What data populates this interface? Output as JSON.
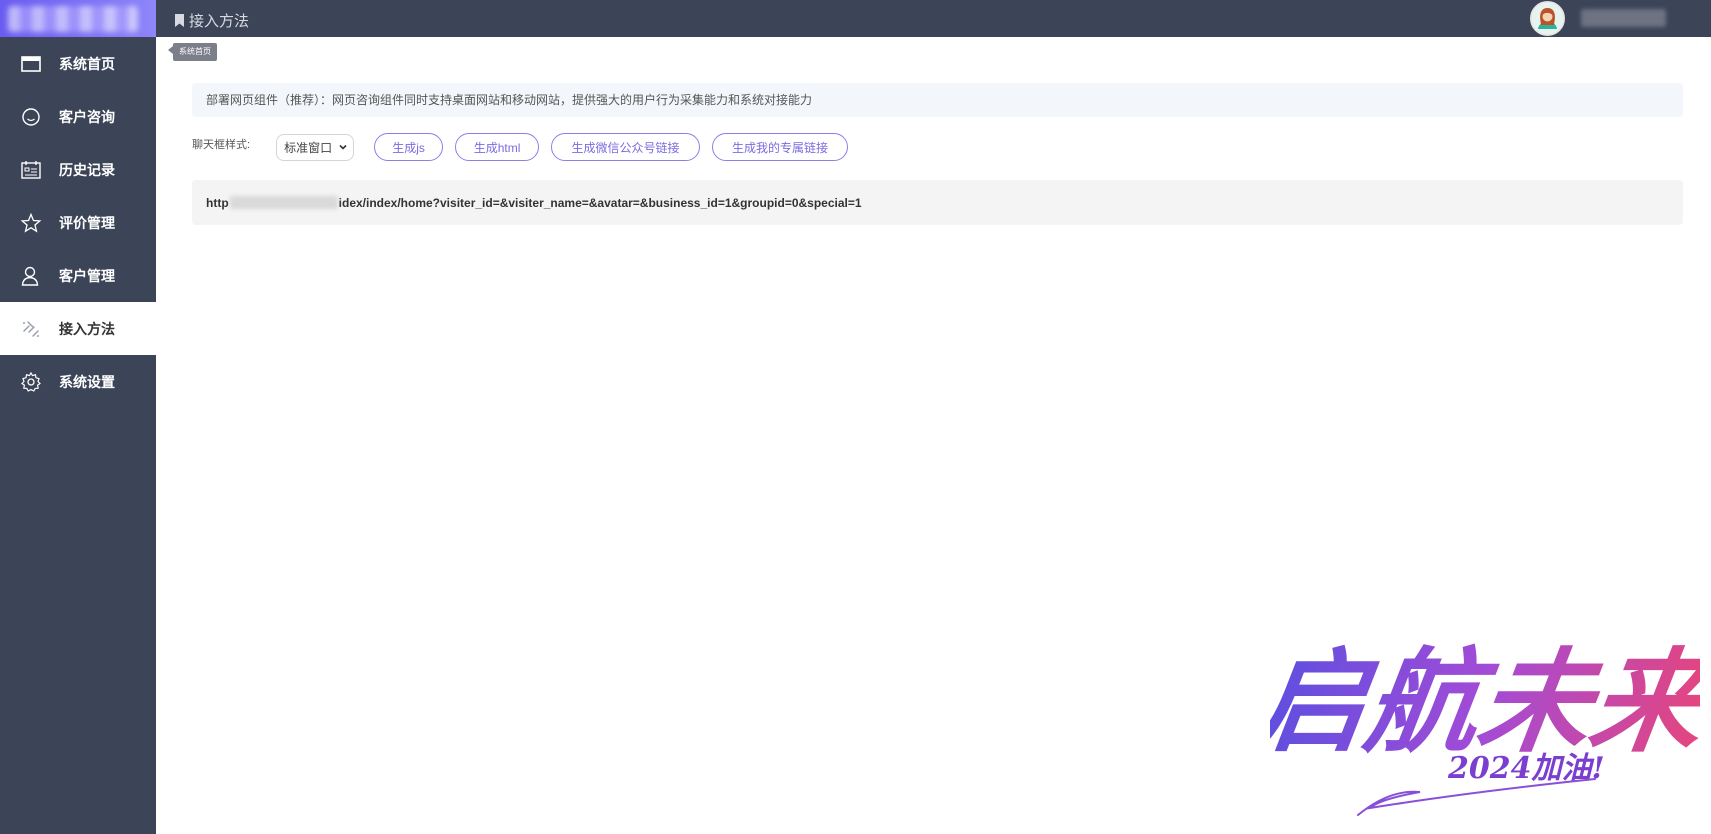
{
  "header": {
    "page_title": "接入方法"
  },
  "sidebar": {
    "items": [
      {
        "label": "系统首页",
        "icon": "window-icon",
        "active": false
      },
      {
        "label": "客户咨询",
        "icon": "smile-icon",
        "active": false
      },
      {
        "label": "历史记录",
        "icon": "calendar-icon",
        "active": false
      },
      {
        "label": "评价管理",
        "icon": "star-icon",
        "active": false
      },
      {
        "label": "客户管理",
        "icon": "user-icon",
        "active": false
      },
      {
        "label": "接入方法",
        "icon": "link-icon",
        "active": true
      },
      {
        "label": "系统设置",
        "icon": "gear-icon",
        "active": false
      }
    ]
  },
  "tooltip": {
    "text": "系统首页"
  },
  "main": {
    "notice": "部署网页组件（推荐）：网页咨询组件同时支持桌面网站和移动网站，提供强大的用户行为采集能力和系统对接能力",
    "style_label": "聊天框样式:",
    "style_select": "标准窗口",
    "buttons": {
      "gen_js": "生成js",
      "gen_html": "生成html",
      "gen_wechat": "生成微信公众号链接",
      "gen_exclusive": "生成我的专属链接"
    },
    "link_prefix": "http",
    "link_suffix": "idex/index/home?visiter_id=&visiter_name=&avatar=&business_id=1&groupid=0&special=1"
  },
  "slogan": {
    "main": "启航未来",
    "sub": "2024加油!"
  },
  "colors": {
    "sidebar_bg": "#3c4458",
    "accent": "#7a6be0",
    "slogan_gradient_start": "#5b4fe0",
    "slogan_gradient_end": "#e8457a"
  }
}
